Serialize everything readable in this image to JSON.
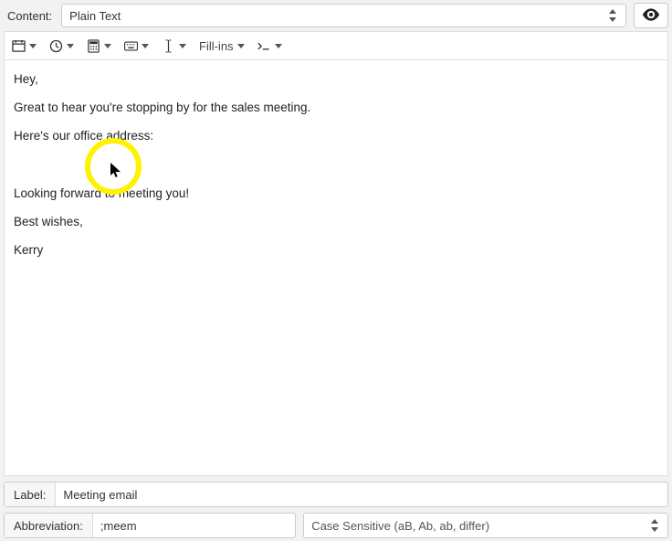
{
  "topRow": {
    "contentLabel": "Content:",
    "contentType": "Plain Text"
  },
  "toolbar": {
    "fillins": "Fill-ins"
  },
  "editor": {
    "lines": [
      "Hey,",
      "Great to hear you're stopping by for the sales meeting.",
      "Here's our office address:",
      "",
      "Looking forward to meeting you!",
      "Best wishes,",
      "Kerry"
    ]
  },
  "bottom": {
    "labelLabel": "Label:",
    "labelValue": "Meeting email",
    "abbrevLabel": "Abbreviation:",
    "abbrevValue": ";meem",
    "caseMode": "Case Sensitive (aB, Ab, ab, differ)"
  }
}
